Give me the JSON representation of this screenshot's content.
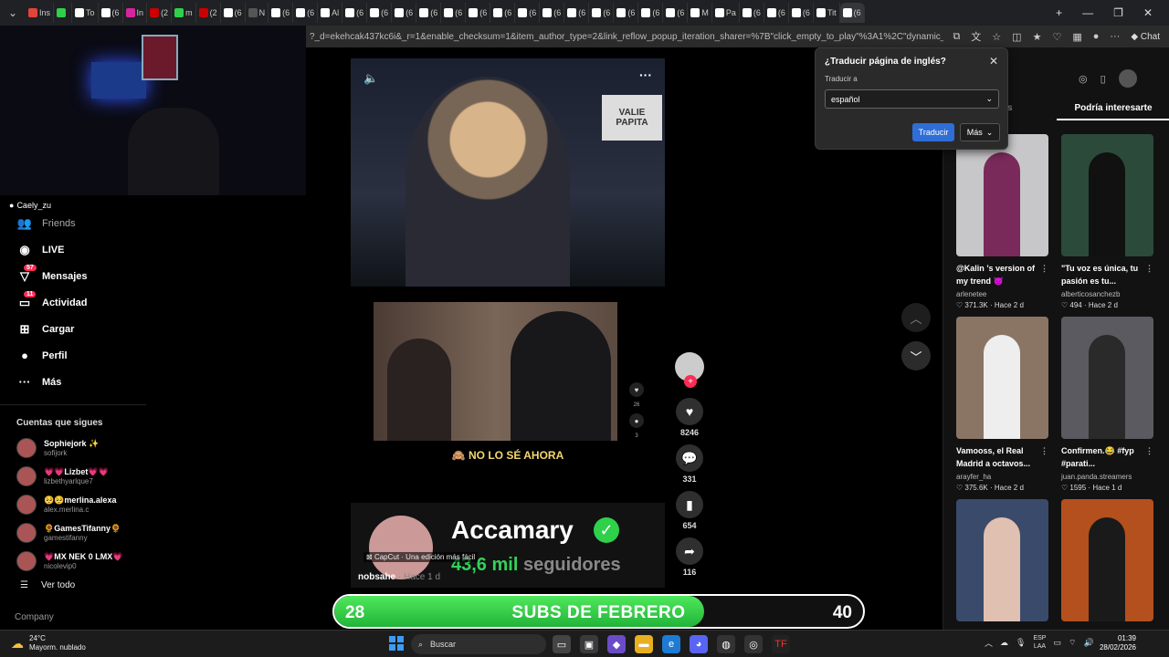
{
  "tabbar": {
    "tabs": [
      {
        "label": "Ins",
        "color": "#e2443a"
      },
      {
        "label": "",
        "color": "#2fd04a"
      },
      {
        "label": "To",
        "color": "#ffffff"
      },
      {
        "label": "(6",
        "color": "#ffffff"
      },
      {
        "label": "In",
        "color": "#d6249f"
      },
      {
        "label": "(2",
        "color": "#cc0000"
      },
      {
        "label": "m",
        "color": "#2fd04a"
      },
      {
        "label": "(2",
        "color": "#cc0000"
      },
      {
        "label": "(6",
        "color": "#ffffff"
      },
      {
        "label": "N",
        "color": "#555555"
      },
      {
        "label": "(6",
        "color": "#ffffff"
      },
      {
        "label": "(6",
        "color": "#ffffff"
      },
      {
        "label": "Al",
        "color": "#ffffff"
      },
      {
        "label": "(6",
        "color": "#ffffff"
      },
      {
        "label": "(6",
        "color": "#ffffff"
      },
      {
        "label": "(6",
        "color": "#ffffff"
      },
      {
        "label": "(6",
        "color": "#ffffff"
      },
      {
        "label": "(6",
        "color": "#ffffff"
      },
      {
        "label": "(6",
        "color": "#ffffff"
      },
      {
        "label": "(6",
        "color": "#ffffff"
      },
      {
        "label": "(6",
        "color": "#ffffff"
      },
      {
        "label": "(6",
        "color": "#ffffff"
      },
      {
        "label": "(6",
        "color": "#ffffff"
      },
      {
        "label": "(6",
        "color": "#ffffff"
      },
      {
        "label": "(6",
        "color": "#ffffff"
      },
      {
        "label": "(6",
        "color": "#ffffff"
      },
      {
        "label": "(6",
        "color": "#ffffff"
      },
      {
        "label": "M",
        "color": "#ffffff"
      },
      {
        "label": "Pa",
        "color": "#ffffff"
      },
      {
        "label": "(6",
        "color": "#ffffff"
      },
      {
        "label": "(6",
        "color": "#ffffff"
      },
      {
        "label": "(6",
        "color": "#ffffff"
      },
      {
        "label": "Tit",
        "color": "#ffffff"
      },
      {
        "label": "(6",
        "color": "#ffffff"
      }
    ]
  },
  "address": {
    "url": "?_d=ekehcak437kc6i&_r=1&enable_checksum=1&item_author_type=2&link_reflow_popup_iteration_sharer=%7B\"click_empty_to_play\"%3A1%2C\"dynamic_cover\"%3A1%...",
    "copilot_label": "Chat"
  },
  "webcam": {
    "tag": "Caely_zu"
  },
  "sidebar": {
    "nav": [
      {
        "label": "Friends",
        "icon": "friends-icon",
        "glyph": "👥",
        "dim": true
      },
      {
        "label": "LIVE",
        "icon": "live-icon",
        "glyph": "◉"
      },
      {
        "label": "Mensajes",
        "icon": "messages-icon",
        "glyph": "▽",
        "badge": "57"
      },
      {
        "label": "Actividad",
        "icon": "activity-icon",
        "glyph": "▭",
        "badge": "11"
      },
      {
        "label": "Cargar",
        "icon": "upload-icon",
        "glyph": "⊞"
      },
      {
        "label": "Perfil",
        "icon": "profile-icon",
        "glyph": "●"
      },
      {
        "label": "Más",
        "icon": "more-icon",
        "glyph": "···"
      }
    ],
    "following_title": "Cuentas que sigues",
    "following": [
      {
        "name": "Sophiejork ✨",
        "user": "sofijork"
      },
      {
        "name": "💗💗Lizbet💗💗",
        "user": "lizbethyarlque7"
      },
      {
        "name": "🥺🥺merlina.alexa",
        "user": "alex.merlina.c"
      },
      {
        "name": "🌻GamesTifanny🌻",
        "user": "gamestifanny"
      },
      {
        "name": "💗MX NEK 0 LMX💗",
        "user": "nicolevip0"
      }
    ],
    "see_all": "Ver todo",
    "company": "Company"
  },
  "feed": {
    "video1": {
      "sign_line1": "VALIE",
      "sign_line2": "PAPITA"
    },
    "video2": {
      "caption": "🙈 NO LO SÉ AHORA"
    },
    "mini_counts": [
      "26",
      "3"
    ],
    "promo": {
      "name": "Accamary",
      "subs_num": "43,6 mil",
      "subs_label": "seguidores",
      "capcut": "CapCut · Una edición más fácil",
      "author": "nobsahe",
      "ago": " · Hace 1 d"
    }
  },
  "actions": {
    "like_count": "8246",
    "comment_count": "331",
    "save_count": "654",
    "share_count": "116"
  },
  "right_panel": {
    "tabs": [
      {
        "label": "tarios"
      },
      {
        "label": "Podría interesarte",
        "active": true
      }
    ],
    "cards": [
      {
        "title": "@Kalin ’s version of my trend 😈",
        "user": "arlenetee",
        "likes": "371.3K",
        "ago": "Hace 2 d",
        "bg": "#c7c7c9",
        "fig": "#7a2a5a"
      },
      {
        "title": "\"Tu voz es única, tu pasión es tu...",
        "user": "alberticosanchezb",
        "likes": "494",
        "ago": "Hace 2 d",
        "bg": "#2c4a3a",
        "fig": "#111111"
      },
      {
        "title": "Vamooss, el Real Madrid a octavos...",
        "user": "arayfer_ha",
        "likes": "375.6K",
        "ago": "Hace 2 d",
        "bg": "#8a7565",
        "fig": "#eeeeee"
      },
      {
        "title": "Confirmen.😂 #fyp #parati...",
        "user": "juan.panda.streamers",
        "likes": "1595",
        "ago": "Hace 1 d",
        "bg": "#5a5a60",
        "fig": "#2a2a2a"
      },
      {
        "title": "",
        "user": "",
        "likes": "",
        "ago": "",
        "bg": "#3a4a6a",
        "fig": "#e0c0b0"
      },
      {
        "title": "",
        "user": "",
        "likes": "",
        "ago": "",
        "bg": "#b4501e",
        "fig": "#1a1a1a"
      }
    ]
  },
  "translate": {
    "question": "¿Traducir página de inglés?",
    "to_label": "Traducir a",
    "language": "español",
    "translate_btn": "Traducir",
    "more_btn": "Más"
  },
  "subs_goal": {
    "current": "28",
    "goal": "40",
    "label": "SUBS DE FEBRERO",
    "progress": 0.7
  },
  "taskbar": {
    "temp": "24°C",
    "weather": "Mayorm. nublado",
    "search": "Buscar",
    "lang_line1": "ESP",
    "lang_line2": "LAA",
    "time": "01:39",
    "date": "28/02/2026"
  }
}
